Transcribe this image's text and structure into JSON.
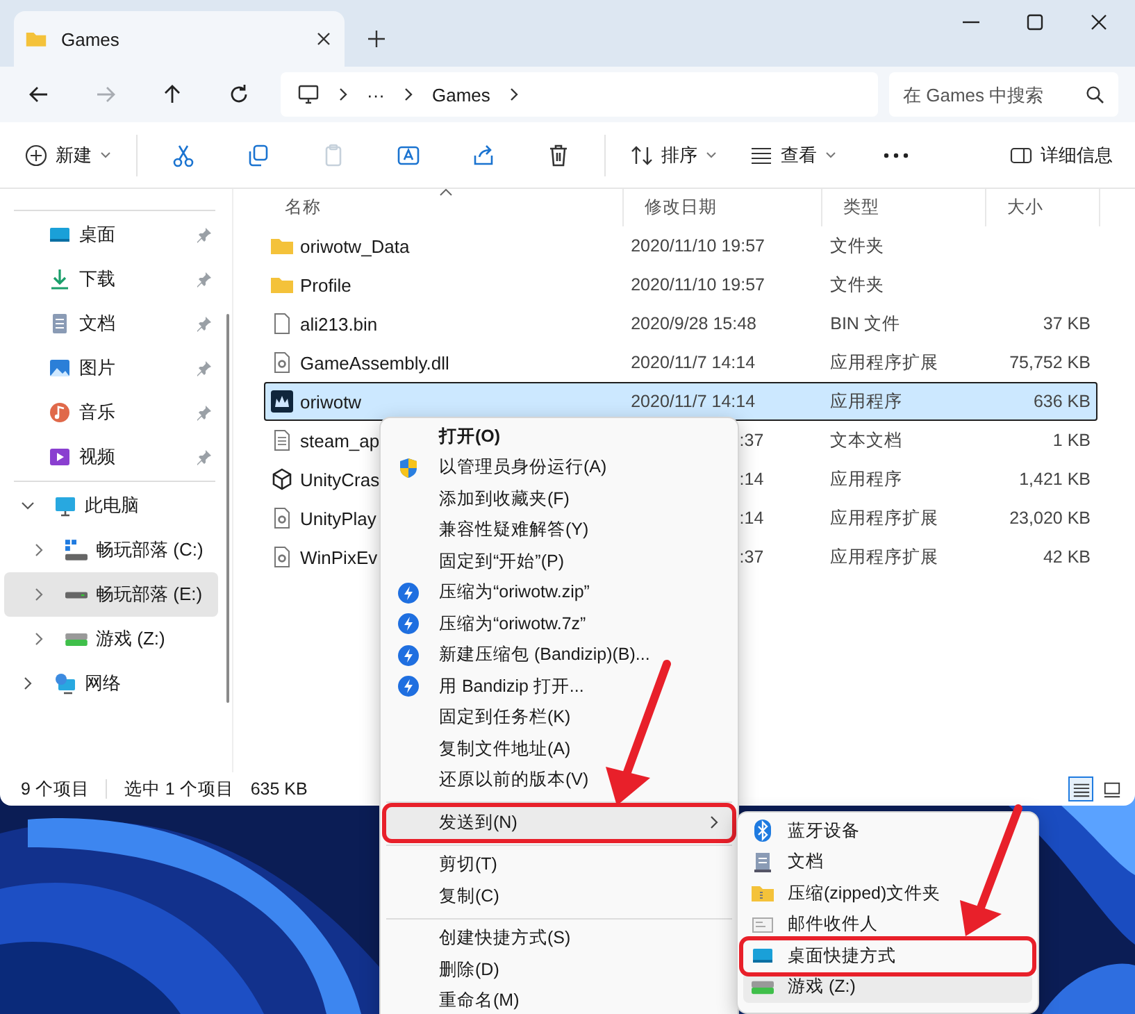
{
  "window": {
    "tab_title": "Games"
  },
  "nav": [
    {
      "kind": "back",
      "disabled": false
    },
    {
      "kind": "forward",
      "disabled": true
    },
    {
      "kind": "up",
      "disabled": false
    },
    {
      "kind": "refresh",
      "disabled": false
    }
  ],
  "address": {
    "crumbs": [
      "···",
      "Games"
    ]
  },
  "search": {
    "placeholder": "在 Games 中搜索"
  },
  "toolbar": {
    "new": "新建",
    "sort": "排序",
    "view": "查看",
    "details": "详细信息",
    "actions": [
      {
        "kind": "cut",
        "disabled": false
      },
      {
        "kind": "copy",
        "disabled": false
      },
      {
        "kind": "paste",
        "disabled": true
      },
      {
        "kind": "rename",
        "disabled": false
      },
      {
        "kind": "share",
        "disabled": false
      },
      {
        "kind": "delete",
        "disabled": false
      }
    ]
  },
  "sidebar": {
    "quick_access": [
      {
        "label": "桌面",
        "kind": "desktop",
        "pinned": true
      },
      {
        "label": "下载",
        "kind": "downloads",
        "pinned": true
      },
      {
        "label": "文档",
        "kind": "documents",
        "pinned": true
      },
      {
        "label": "图片",
        "kind": "pictures",
        "pinned": true
      },
      {
        "label": "音乐",
        "kind": "music",
        "pinned": true
      },
      {
        "label": "视频",
        "kind": "videos",
        "pinned": true
      }
    ],
    "tree": [
      {
        "label": "此电脑",
        "kind": "pc",
        "expanded": true,
        "selected": false,
        "children": [
          {
            "label": "畅玩部落 (C:)",
            "kind": "system-drive",
            "expanded": false,
            "selected": false
          },
          {
            "label": "畅玩部落 (E:)",
            "kind": "drive",
            "expanded": false,
            "selected": true
          },
          {
            "label": "游戏 (Z:)",
            "kind": "game-drive",
            "expanded": false,
            "selected": false
          }
        ]
      },
      {
        "label": "网络",
        "kind": "network",
        "expanded": false,
        "selected": false
      }
    ]
  },
  "table": {
    "columns": [
      {
        "label": "名称",
        "sorted": true
      },
      {
        "label": "修改日期",
        "sorted": false
      },
      {
        "label": "类型",
        "sorted": false
      },
      {
        "label": "大小",
        "sorted": false
      }
    ],
    "rows": [
      {
        "name": "oriwotw_Data",
        "date": "2020/11/10 19:57",
        "type": "文件夹",
        "kind": "folder",
        "selected": false,
        "covered": false
      },
      {
        "name": "Profile",
        "date": "2020/11/10 19:57",
        "type": "文件夹",
        "kind": "folder",
        "selected": false,
        "covered": false
      },
      {
        "name": "ali213.bin",
        "date": "2020/9/28 15:48",
        "type": "BIN 文件",
        "size": "37 KB",
        "kind": "file",
        "selected": false,
        "covered": false
      },
      {
        "name": "GameAssembly.dll",
        "date": "2020/11/7 14:14",
        "type": "应用程序扩展",
        "size": "75,752 KB",
        "kind": "dll",
        "selected": false,
        "covered": false
      },
      {
        "name": "oriwotw",
        "date": "2020/11/7 14:14",
        "type": "应用程序",
        "size": "636 KB",
        "kind": "app",
        "selected": true,
        "covered": false
      },
      {
        "name": "steam_ap",
        "date": ":37",
        "type": "文本文档",
        "size": "1 KB",
        "kind": "text",
        "selected": false,
        "covered": true
      },
      {
        "name": "UnityCras",
        "date": ":14",
        "type": "应用程序",
        "size": "1,421 KB",
        "kind": "unity",
        "selected": false,
        "covered": true
      },
      {
        "name": "UnityPlay",
        "date": ":14",
        "type": "应用程序扩展",
        "size": "23,020 KB",
        "kind": "dll",
        "selected": false,
        "covered": true
      },
      {
        "name": "WinPixEv",
        "date": ":37",
        "type": "应用程序扩展",
        "size": "42 KB",
        "kind": "dll",
        "selected": false,
        "covered": true
      }
    ]
  },
  "status_bar": {
    "count": "9 个项目",
    "selection": "选中 1 个项目",
    "size": "635 KB",
    "views": [
      {
        "kind": "details",
        "selected": true
      },
      {
        "kind": "tiles",
        "selected": false
      }
    ]
  },
  "context_menu": {
    "items": [
      {
        "kind": "plain",
        "label": "打开(O)",
        "bold": true
      },
      {
        "kind": "admin",
        "label": "以管理员身份运行(A)"
      },
      {
        "kind": "plain",
        "label": "添加到收藏夹(F)"
      },
      {
        "kind": "plain",
        "label": "兼容性疑难解答(Y)"
      },
      {
        "kind": "plain",
        "label": "固定到“开始”(P)"
      },
      {
        "kind": "zip",
        "label": "压缩为“oriwotw.zip”"
      },
      {
        "kind": "zip",
        "label": "压缩为“oriwotw.7z”"
      },
      {
        "kind": "zip",
        "label": "新建压缩包 (Bandizip)(B)..."
      },
      {
        "kind": "zip",
        "label": "用 Bandizip 打开..."
      },
      {
        "kind": "plain",
        "label": "固定到任务栏(K)"
      },
      {
        "kind": "plain",
        "label": "复制文件地址(A)"
      },
      {
        "kind": "plain",
        "label": "还原以前的版本(V)"
      },
      {
        "kind": "separator"
      },
      {
        "kind": "plain",
        "label": "发送到(N)",
        "submenu": true,
        "highlighted": true,
        "marked": true
      },
      {
        "kind": "separator"
      },
      {
        "kind": "plain",
        "label": "剪切(T)"
      },
      {
        "kind": "plain",
        "label": "复制(C)"
      },
      {
        "kind": "separator"
      },
      {
        "kind": "plain",
        "label": "创建快捷方式(S)"
      },
      {
        "kind": "plain",
        "label": "删除(D)"
      },
      {
        "kind": "plain",
        "label": "重命名(M)"
      }
    ]
  },
  "submenu": {
    "items": [
      {
        "label": "蓝牙设备",
        "kind": "bluetooth",
        "highlighted": false,
        "marked": false
      },
      {
        "label": "文档",
        "kind": "documents",
        "highlighted": false,
        "marked": false
      },
      {
        "label": "压缩(zipped)文件夹",
        "kind": "zip-folder",
        "highlighted": false,
        "marked": false
      },
      {
        "label": "邮件收件人",
        "kind": "mail",
        "highlighted": false,
        "marked": false
      },
      {
        "label": "桌面快捷方式",
        "kind": "desktop",
        "highlighted": false,
        "marked": true
      },
      {
        "label": "游戏 (Z:)",
        "kind": "drive",
        "highlighted": true,
        "marked": false
      }
    ]
  }
}
